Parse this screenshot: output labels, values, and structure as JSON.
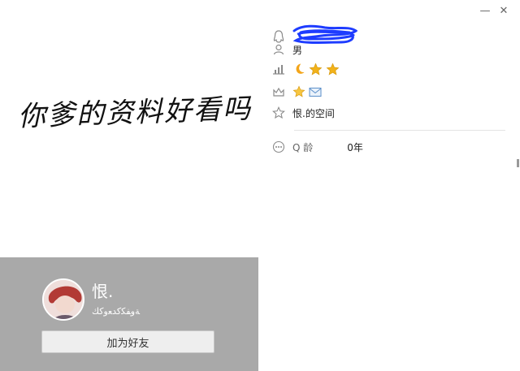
{
  "profile": {
    "handwriting_text": "你爹的资料好看吗",
    "nickname": "恨.",
    "signature": "ﺔﻭﻔﻜﻛﺪﻌﻭﻛﻚ",
    "add_friend_label": "加为好友"
  },
  "details": {
    "gender": "男",
    "space_label": "恨.的空间",
    "qage_label": "Q 龄",
    "qage_value": "0年",
    "level_badges": [
      "moon-icon",
      "star-icon",
      "star-icon"
    ],
    "vip_badges": [
      "star-icon",
      "mail-icon"
    ]
  },
  "window": {
    "minimize_label": "—",
    "close_label": "✕"
  },
  "colors": {
    "card_bg": "#a9a9a9",
    "icon_gray": "#8a8a8a",
    "star_gold": "#f2b21a",
    "moon_gold": "#f3a51a",
    "scribble_blue": "#1e3cff"
  }
}
